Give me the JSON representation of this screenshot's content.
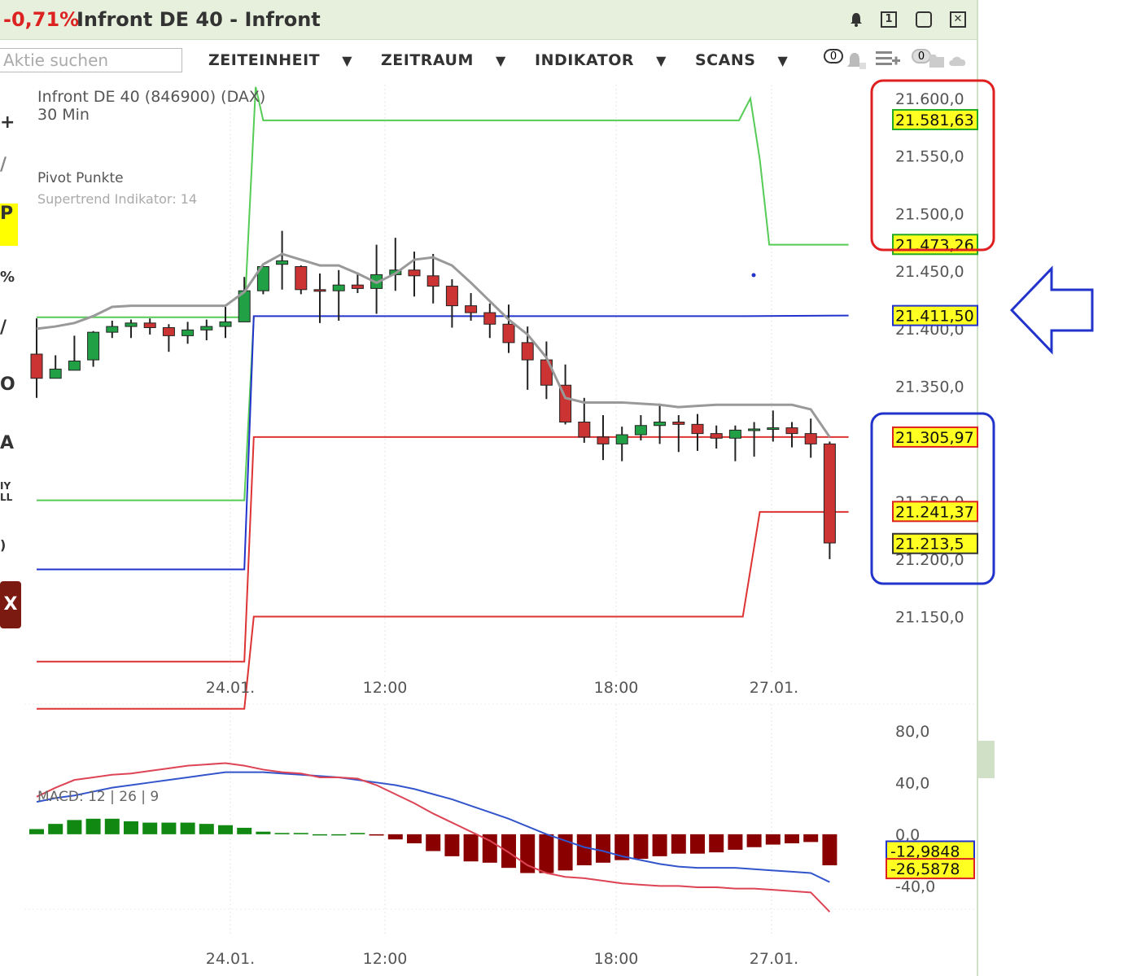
{
  "window": {
    "change": "-0,71%",
    "title": "Infront DE 40 - Infront",
    "buttons": [
      "bell-icon",
      "window-1-icon",
      "restore-icon",
      "close-icon"
    ]
  },
  "toolbar": {
    "search_placeholder": "Aktie suchen",
    "menus": [
      {
        "label": "ZEITEINHEIT",
        "arrow": "▼"
      },
      {
        "label": "ZEITRAUM",
        "arrow": "▼"
      },
      {
        "label": "INDIKATOR",
        "arrow": "▼"
      },
      {
        "label": "SCANS",
        "arrow": "▼"
      }
    ],
    "alert_count": "0",
    "watch_count": "0"
  },
  "chart": {
    "instrument": "Infront DE 40 (846900) (DAX)",
    "interval": "30 Min",
    "legend_pivot": "Pivot Punkte",
    "legend_supertrend": "Supertrend Indikator: 14",
    "x_ticks": [
      "24.01.",
      "12:00",
      "18:00",
      "27.01."
    ],
    "y_ticks": [
      "21.600,0",
      "21.550,0",
      "21.500,0",
      "21.450,0",
      "21.400,0",
      "21.350,0",
      "21.250,0",
      "21.200,0",
      "21.150,0"
    ],
    "price_labels": [
      {
        "text": "21.581,63",
        "value": 21581.63,
        "border": "#22aa22"
      },
      {
        "text": "21.473,26",
        "value": 21473.26,
        "border": "#22aa22"
      },
      {
        "text": "21.411,50",
        "value": 21411.5,
        "border": "#2233cc"
      },
      {
        "text": "21.305,97",
        "value": 21305.97,
        "border": "#dd2222"
      },
      {
        "text": "21.241,37",
        "value": 21241.37,
        "border": "#dd2222"
      },
      {
        "text": "21.213,5",
        "value": 21213.5,
        "border": "#333333"
      }
    ]
  },
  "macd": {
    "label": "MACD: 12 | 26 | 9",
    "y_ticks": [
      "80,0",
      "40,0",
      "0,0",
      "-40,0"
    ],
    "value_labels": [
      {
        "text": "-12,9848",
        "value": -12.9848,
        "border": "#2233cc"
      },
      {
        "text": "-26,5878",
        "value": -26.5878,
        "border": "#dd2222"
      }
    ],
    "x_ticks": [
      "24.01.",
      "12:00",
      "18:00",
      "27.01."
    ]
  },
  "chart_data": {
    "type": "candlestick",
    "price_range": [
      21120,
      21612
    ],
    "candles": [
      [
        21378,
        21357,
        21409,
        21340
      ],
      [
        21357,
        21365,
        21377,
        21364
      ],
      [
        21364,
        21372,
        21394,
        21369
      ],
      [
        21373,
        21397,
        21398,
        21367
      ],
      [
        21397,
        21402,
        21407,
        21392
      ],
      [
        21402,
        21405,
        21408,
        21392
      ],
      [
        21405,
        21401,
        21409,
        21395
      ],
      [
        21401,
        21394,
        21404,
        21380
      ],
      [
        21394,
        21399,
        21406,
        21387
      ],
      [
        21399,
        21402,
        21408,
        21390
      ],
      [
        21402,
        21406,
        21419,
        21392
      ],
      [
        21406,
        21433,
        21445,
        21407
      ],
      [
        21433,
        21454,
        21448,
        21430
      ],
      [
        21456,
        21459,
        21485,
        21434
      ],
      [
        21454,
        21434,
        21455,
        21430
      ],
      [
        21434,
        21433,
        21448,
        21405
      ],
      [
        21433,
        21438,
        21451,
        21407
      ],
      [
        21438,
        21435,
        21449,
        21431
      ],
      [
        21435,
        21447,
        21473,
        21413
      ],
      [
        21447,
        21451,
        21479,
        21433
      ],
      [
        21451,
        21446,
        21467,
        21428
      ],
      [
        21446,
        21437,
        21465,
        21422
      ],
      [
        21437,
        21420,
        21443,
        21401
      ],
      [
        21420,
        21414,
        21431,
        21407
      ],
      [
        21414,
        21404,
        21422,
        21392
      ],
      [
        21404,
        21388,
        21421,
        21379
      ],
      [
        21388,
        21373,
        21402,
        21347
      ],
      [
        21373,
        21351,
        21389,
        21339
      ],
      [
        21351,
        21319,
        21369,
        21317
      ],
      [
        21319,
        21306,
        21340,
        21301
      ],
      [
        21306,
        21300,
        21325,
        21286
      ],
      [
        21300,
        21308,
        21315,
        21285
      ],
      [
        21308,
        21316,
        21325,
        21303
      ],
      [
        21316,
        21319,
        21335,
        21300
      ],
      [
        21319,
        21317,
        21325,
        21293
      ],
      [
        21317,
        21309,
        21326,
        21294
      ],
      [
        21309,
        21305,
        21316,
        21296
      ],
      [
        21305,
        21312,
        21316,
        21285
      ],
      [
        21312,
        21313,
        21319,
        21289
      ],
      [
        21313,
        21314,
        21329,
        21302
      ],
      [
        21314,
        21309,
        21319,
        21297
      ],
      [
        21309,
        21300,
        21322,
        21288
      ],
      [
        21300,
        21214,
        21302,
        21200
      ]
    ],
    "supertrend": [
      21400,
      21402,
      21405,
      21411,
      21419,
      21420,
      21420,
      21420,
      21420,
      21420,
      21420,
      21432,
      21456,
      21465,
      21460,
      21455,
      21455,
      21448,
      21440,
      21448,
      21460,
      21462,
      21455,
      21440,
      21424,
      21408,
      21395,
      21375,
      21340,
      21336,
      21336,
      21336,
      21335,
      21334,
      21332,
      21333,
      21334,
      21334,
      21334,
      21334,
      21334,
      21330,
      21306
    ],
    "pivot_lines": {
      "green_upper": [
        [
          0,
          21410
        ],
        [
          11,
          21410
        ],
        [
          11.6,
          21610
        ],
        [
          12,
          21581
        ],
        [
          37.2,
          21581
        ],
        [
          37.8,
          21600
        ],
        [
          38.3,
          21547
        ],
        [
          38.8,
          21473
        ],
        [
          43,
          21473
        ]
      ],
      "green_lower": [
        [
          0,
          21251
        ],
        [
          11,
          21251
        ],
        [
          11.5,
          21410
        ]
      ],
      "blue": [
        [
          0,
          21191
        ],
        [
          11,
          21191
        ],
        [
          11.5,
          21411
        ],
        [
          37.5,
          21411
        ],
        [
          43,
          21411.5
        ]
      ],
      "red_upper": [
        [
          0,
          21111
        ],
        [
          11,
          21111
        ],
        [
          11.5,
          21306
        ],
        [
          37.5,
          21306
        ],
        [
          38.2,
          21306
        ],
        [
          43,
          21306
        ]
      ],
      "red_lower": [
        [
          0,
          21070
        ],
        [
          11,
          21070
        ],
        [
          11.5,
          21150
        ],
        [
          37.4,
          21150
        ],
        [
          38.3,
          21241
        ],
        [
          43,
          21241
        ]
      ]
    },
    "macd_range": [
      -58,
      100
    ],
    "macd_line": [
      25,
      28,
      30,
      33,
      36,
      38,
      40,
      42,
      44,
      46,
      48,
      48,
      48,
      47,
      46,
      45,
      44,
      42,
      40,
      38,
      35,
      31,
      27,
      22,
      17,
      12,
      6,
      0,
      -5,
      -10,
      -13,
      -17,
      -20,
      -23,
      -25,
      -26,
      -26,
      -26,
      -27,
      -28,
      -29,
      -30,
      -37
    ],
    "signal_line": [
      29,
      36,
      42,
      44,
      46,
      47,
      49,
      51,
      53,
      54,
      55,
      53,
      50,
      48,
      47,
      44,
      44,
      43,
      38,
      31,
      24,
      16,
      9,
      2,
      -5,
      -14,
      -24,
      -30,
      -33,
      -34,
      -36,
      -38,
      -39,
      -40,
      -40,
      -41,
      -41,
      -42,
      -42,
      -43,
      -44,
      -45,
      -60
    ],
    "histogram": [
      -4,
      -8,
      -11,
      -12,
      -12,
      -10,
      -9,
      -9,
      -9,
      -8,
      -7,
      -5,
      -2,
      -1,
      -1,
      0,
      0,
      -1,
      1,
      4,
      7,
      13,
      17,
      21,
      22,
      26,
      30,
      30,
      28,
      24,
      22,
      20,
      19,
      17,
      15,
      15,
      14,
      12,
      10,
      8,
      7,
      6,
      24
    ],
    "histogram_note": "sign inverted: bars above zero = positive MACD histogram, below = negative"
  }
}
